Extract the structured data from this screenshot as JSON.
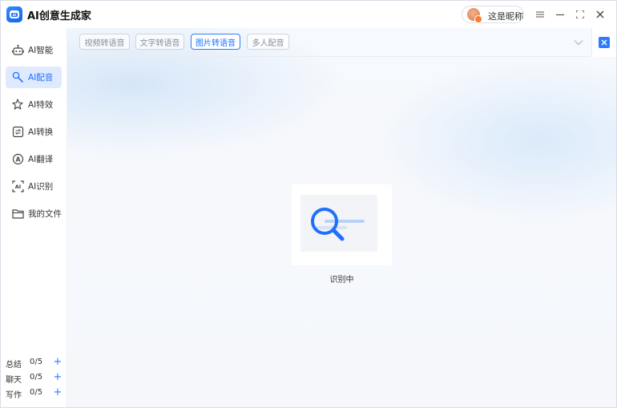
{
  "app": {
    "title": "AI创意生成家",
    "user_name": "这是昵称"
  },
  "colors": {
    "accent": "#2f7bff",
    "active_bg": "#dfeaff"
  },
  "window_controls": [
    {
      "name": "menu-icon"
    },
    {
      "name": "minimize-icon"
    },
    {
      "name": "maximize-icon"
    },
    {
      "name": "close-icon"
    }
  ],
  "sidebar": {
    "items": [
      {
        "label": "AI智能",
        "icon": "robot-icon",
        "active": false
      },
      {
        "label": "AI配音",
        "icon": "microphone-icon",
        "active": true
      },
      {
        "label": "AI特效",
        "icon": "sparkle-icon",
        "active": false
      },
      {
        "label": "AI转换",
        "icon": "convert-icon",
        "active": false
      },
      {
        "label": "AI翻译",
        "icon": "translate-icon",
        "active": false
      },
      {
        "label": "AI识别",
        "icon": "recognize-icon",
        "active": false
      },
      {
        "label": "我的文件",
        "icon": "folder-icon",
        "active": false
      }
    ],
    "quotas": [
      {
        "name": "总结",
        "value": "0/5"
      },
      {
        "name": "聊天",
        "value": "0/5"
      },
      {
        "name": "写作",
        "value": "0/5"
      }
    ]
  },
  "tabs": [
    {
      "label": "视频转语音",
      "active": false
    },
    {
      "label": "文字转语音",
      "active": false
    },
    {
      "label": "图片转语音",
      "active": true
    },
    {
      "label": "多人配音",
      "active": false
    }
  ],
  "main": {
    "status": "识别中"
  }
}
